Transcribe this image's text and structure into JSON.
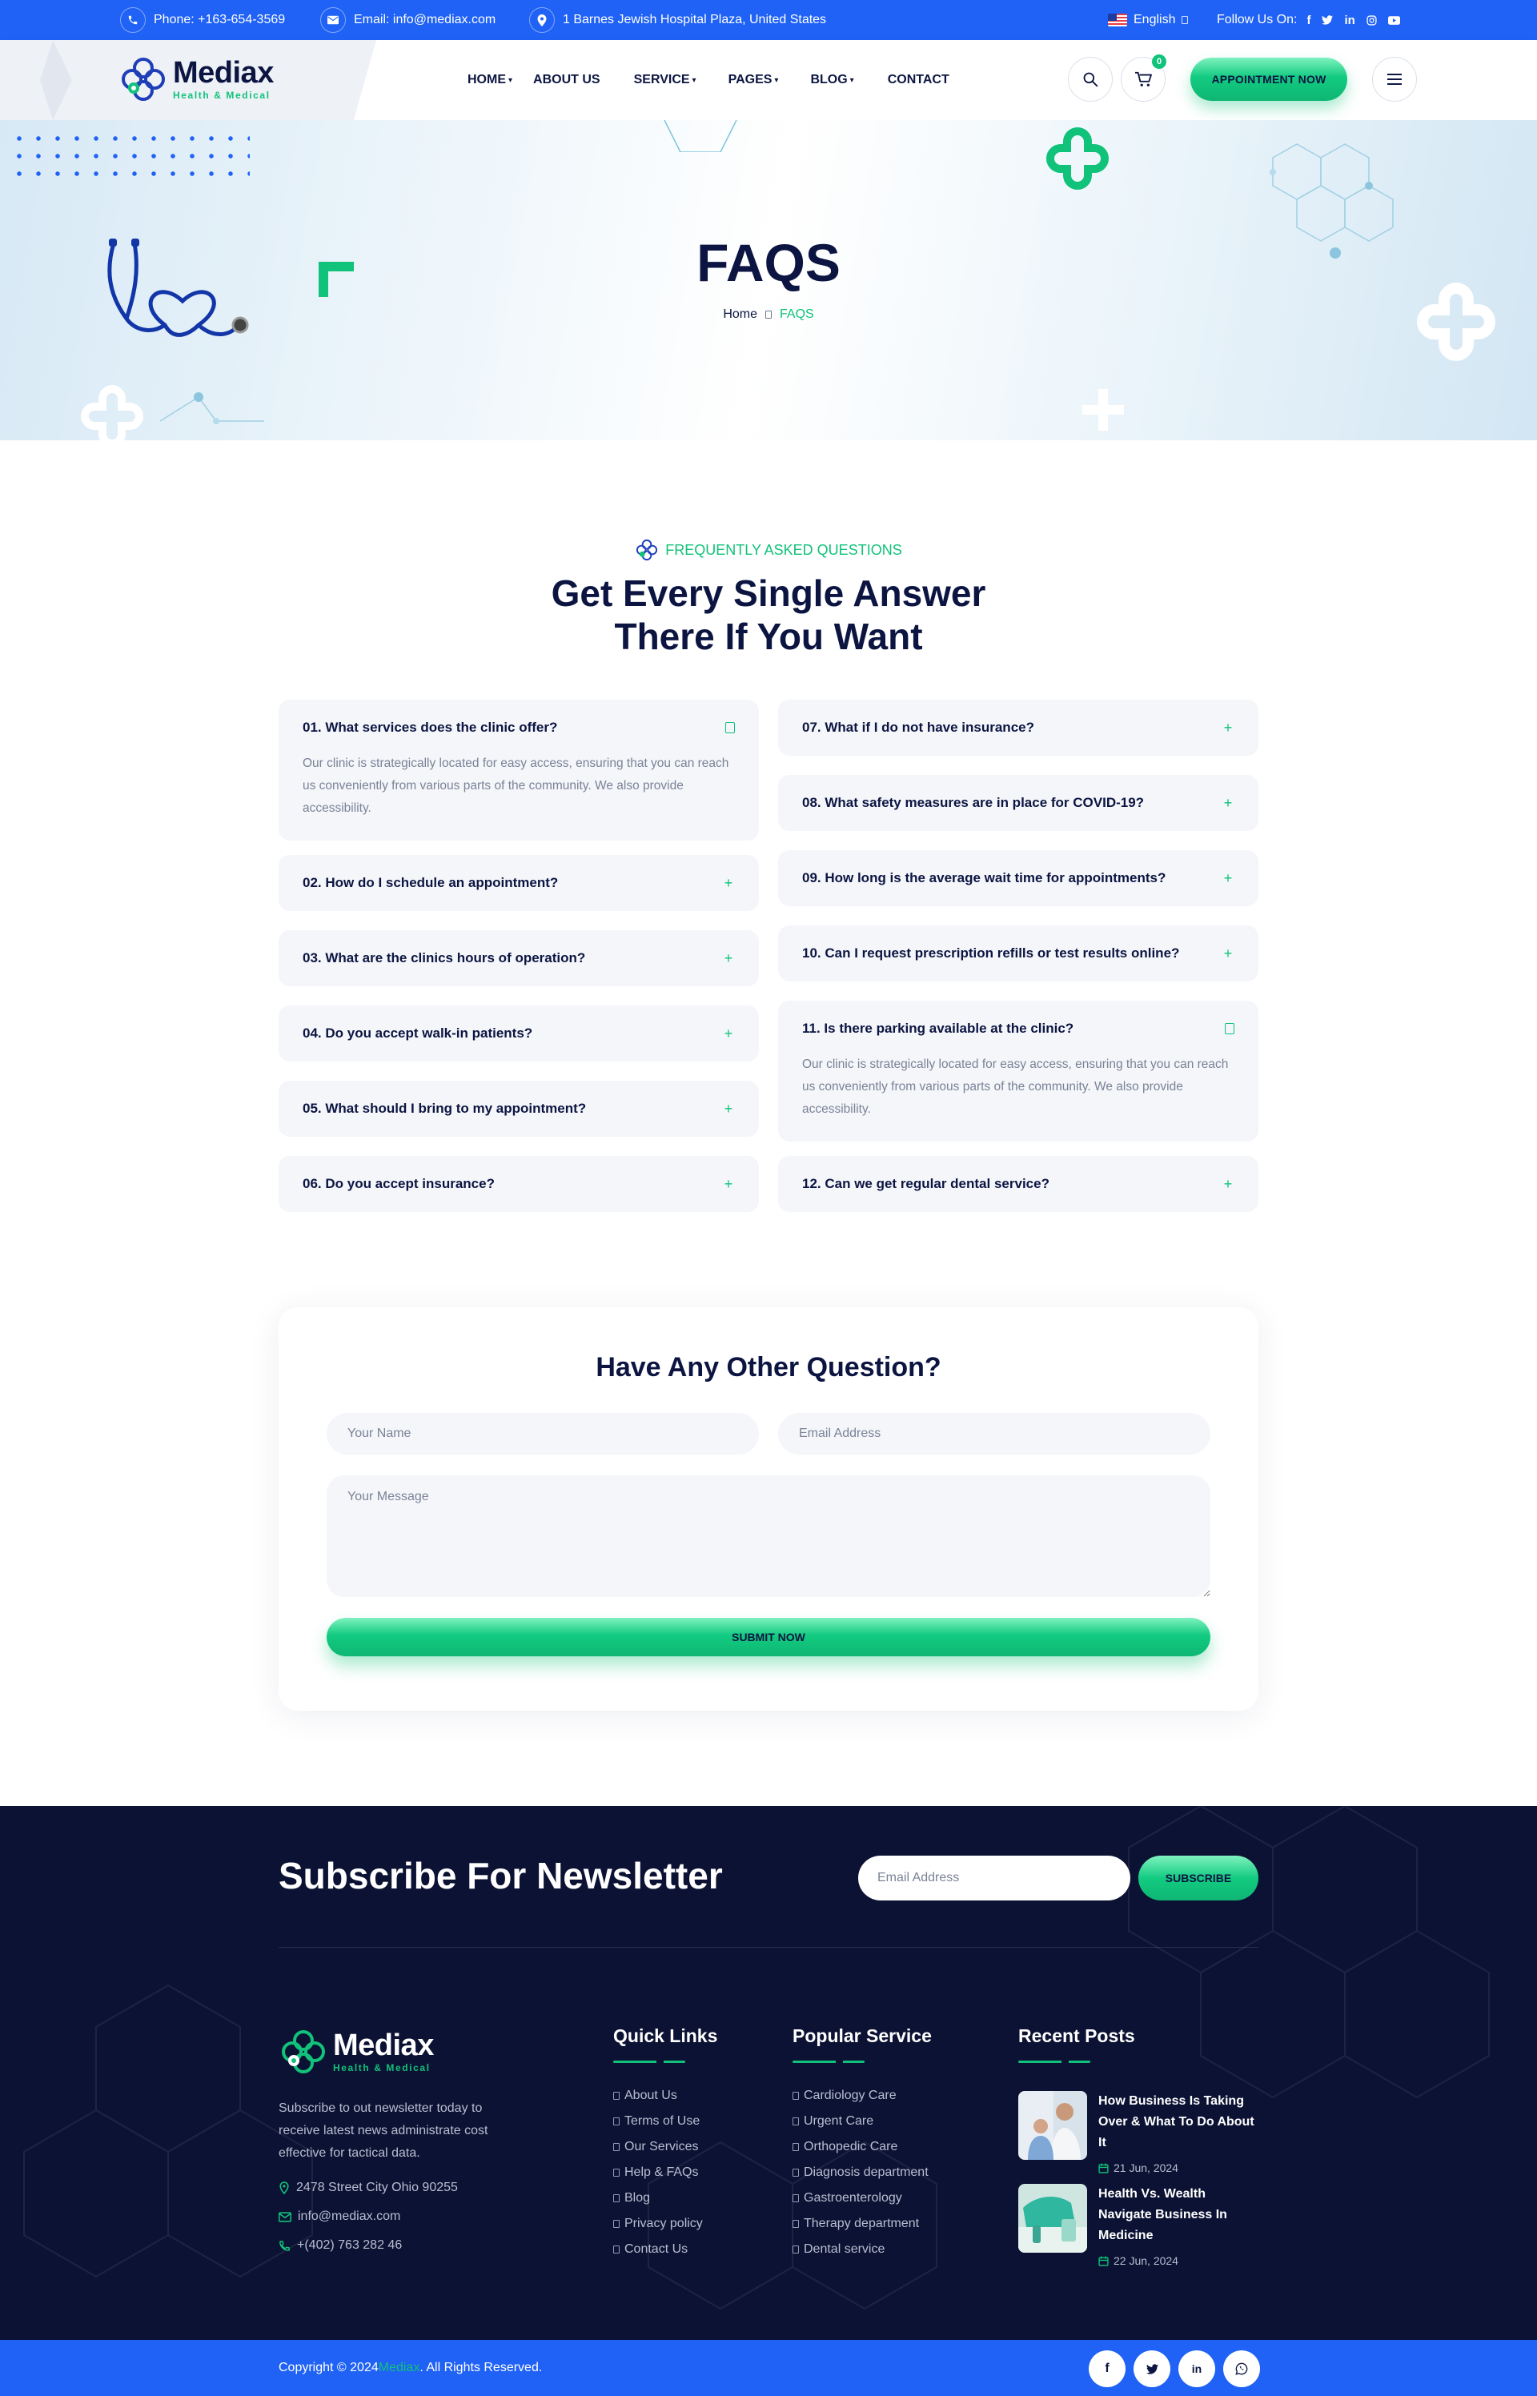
{
  "topbar": {
    "phone": "Phone: +163-654-3569",
    "email": "Email: info@mediax.com",
    "address": "1 Barnes Jewish Hospital Plaza, United States",
    "language": "English",
    "follow_label": "Follow Us On:",
    "social": [
      "f",
      "t",
      "in",
      "ig",
      "yt"
    ]
  },
  "header": {
    "logo_word": "Mediax",
    "logo_sub": "Health & Medical",
    "nav": [
      {
        "label": "HOME",
        "dropdown": true
      },
      {
        "label": "ABOUT US",
        "dropdown": false
      },
      {
        "label": "SERVICE",
        "dropdown": true
      },
      {
        "label": "PAGES",
        "dropdown": true
      },
      {
        "label": "BLOG",
        "dropdown": true
      },
      {
        "label": "CONTACT",
        "dropdown": false
      }
    ],
    "cart_count": "0",
    "appointment_label": "APPOINTMENT NOW"
  },
  "hero": {
    "title": "FAQS",
    "breadcrumb_home": "Home",
    "breadcrumb_sep": "",
    "breadcrumb_current": "FAQS"
  },
  "faq_section": {
    "eyebrow": "FREQUENTLY ASKED QUESTIONS",
    "title_line1": "Get Every Single Answer",
    "title_line2": "There If You Want",
    "left": [
      {
        "q": "01. What services does the clinic offer?",
        "open": true,
        "a": "Our clinic is strategically located for easy access, ensuring that you can reach us conveniently from various parts of the community. We also provide accessibility."
      },
      {
        "q": "02. How do I schedule an appointment?",
        "open": false
      },
      {
        "q": "03. What are the clinics hours of operation?",
        "open": false
      },
      {
        "q": "04. Do you accept walk-in patients?",
        "open": false
      },
      {
        "q": "05. What should I bring to my appointment?",
        "open": false
      },
      {
        "q": "06. Do you accept insurance?",
        "open": false
      }
    ],
    "right": [
      {
        "q": "07. What if I do not have insurance?",
        "open": false
      },
      {
        "q": "08. What safety measures are in place for COVID-19?",
        "open": false
      },
      {
        "q": "09. How long is the average wait time for appointments?",
        "open": false
      },
      {
        "q": "10. Can I request prescription refills or test results online?",
        "open": false
      },
      {
        "q": "11. Is there parking available at the clinic?",
        "open": true,
        "a": "Our clinic is strategically located for easy access, ensuring that you can reach us conveniently from various parts of the community. We also provide accessibility."
      },
      {
        "q": "12. Can we get regular dental service?",
        "open": false
      }
    ]
  },
  "contact_form": {
    "title": "Have Any Other Question?",
    "name_placeholder": "Your Name",
    "email_placeholder": "Email Address",
    "message_placeholder": "Your Message",
    "submit_label": "SUBMIT NOW"
  },
  "footer": {
    "newsletter_title": "Subscribe For Newsletter",
    "newsletter_placeholder": "Email Address",
    "subscribe_label": "SUBSCRIBE",
    "logo_word": "Mediax",
    "logo_sub": "Health & Medical",
    "about": "Subscribe to out newsletter today to receive latest news administrate cost effective for tactical data.",
    "address": "2478 Street City Ohio 90255",
    "email": "info@mediax.com",
    "phone": "+(402) 763 282 46",
    "quick_links_title": "Quick Links",
    "quick_links": [
      "About Us",
      "Terms of Use",
      "Our Services",
      "Help & FAQs",
      "Blog",
      "Privacy policy",
      "Contact Us"
    ],
    "popular_service_title": "Popular Service",
    "popular_services": [
      "Cardiology Care",
      "Urgent Care",
      "Orthopedic Care",
      "Diagnosis department",
      "Gastroenterology",
      "Therapy department",
      "Dental service"
    ],
    "recent_posts_title": "Recent Posts",
    "posts": [
      {
        "title": "How Business Is Taking Over & What To Do About It",
        "date": "21 Jun, 2024"
      },
      {
        "title": "Health Vs. Wealth Navigate Business In Medicine",
        "date": "22 Jun, 2024"
      }
    ],
    "copyright_prefix": "Copyright © 2024 ",
    "copyright_brand": "Mediax",
    "copyright_suffix": ". All Rights Reserved.",
    "bottom_social": [
      "f",
      "t",
      "in",
      "wa"
    ]
  },
  "colors": {
    "primary_blue": "#1f62f5",
    "accent_green": "#10c27a",
    "navy": "#0c1541",
    "footer_bg": "#0c1233"
  }
}
